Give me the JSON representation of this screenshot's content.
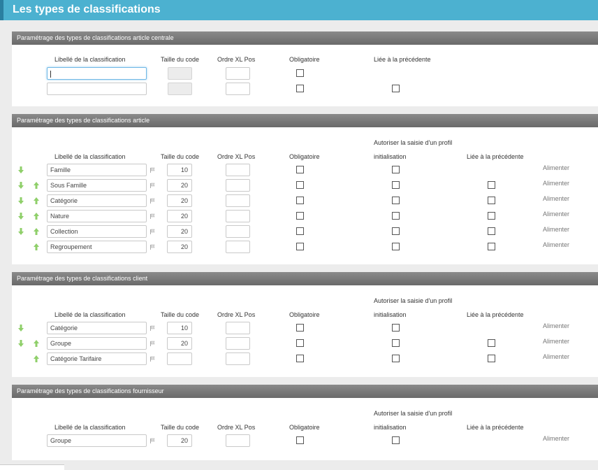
{
  "page": {
    "title": "Les types de classifications"
  },
  "colors": {
    "title_bar": "#4cb1d0",
    "panel_header": "#777777",
    "arrow": "#8fcf6a"
  },
  "columns": {
    "libelle": "Libellé de la classification",
    "taille": "Taille du code",
    "ordre": "Ordre XL Pos",
    "obligatoire": "Obligatoire",
    "liee": "Liée à la précédente",
    "autoriser": "Autoriser la saisie d'un profil",
    "initialisation": "initialisation"
  },
  "action_label": "Alimenter",
  "sections": {
    "centrale": {
      "title": "Paramétrage des types de classifications article centrale",
      "rows": [
        {
          "label": "",
          "code": "",
          "ordre": ""
        },
        {
          "label": "",
          "code": "",
          "ordre": ""
        }
      ]
    },
    "article": {
      "title": "Paramétrage des types de classifications article",
      "rows": [
        {
          "label": "Famille",
          "code": "10",
          "ordre": ""
        },
        {
          "label": "Sous Famille",
          "code": "20",
          "ordre": ""
        },
        {
          "label": "Catégorie",
          "code": "20",
          "ordre": ""
        },
        {
          "label": "Nature",
          "code": "20",
          "ordre": ""
        },
        {
          "label": "Collection",
          "code": "20",
          "ordre": ""
        },
        {
          "label": "Regroupement",
          "code": "20",
          "ordre": ""
        }
      ]
    },
    "client": {
      "title": "Paramétrage des types de classifications client",
      "rows": [
        {
          "label": "Catégorie",
          "code": "10",
          "ordre": ""
        },
        {
          "label": "Groupe",
          "code": "20",
          "ordre": ""
        },
        {
          "label": "Catégorie Tarifaire",
          "code": "",
          "ordre": ""
        }
      ]
    },
    "fournisseur": {
      "title": "Paramétrage des types de classifications fournisseur",
      "rows": [
        {
          "label": "Groupe",
          "code": "20",
          "ordre": ""
        }
      ]
    }
  }
}
